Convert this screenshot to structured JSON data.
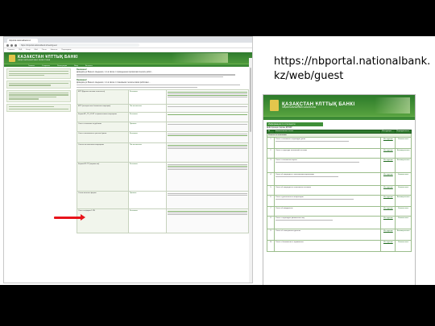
{
  "caption": {
    "url": "https://nbportal.nationalbank.kz/web/guest"
  },
  "screenshot_left": {
    "browser": {
      "tab_title": "nbportal.nationalbank.kz",
      "address": "https://nbportal.nationalbank.kz/web/guest",
      "bookmarks": [
        "Сервисы",
        "ГБД",
        "Kaspi",
        "Mail",
        "Почта",
        "Новости",
        "Переводчик"
      ]
    },
    "site": {
      "title": "КАЗАКСТАН ҰЛТТЫҚ БАНКІ",
      "subtitle": "НАЦИОНАЛЬНЫЙ БАНК КАЗАХСТАНА",
      "menu": [
        "Главная",
        "О портале",
        "Регистрация",
        "Вход",
        "Контакты"
      ]
    },
    "notices": [
      {
        "label": "Внимание!",
        "text": "Доводим до Вашего сведения, что в связи с проведением профилактических работ..."
      },
      {
        "label": "Внимание!",
        "text": "Доводим до Вашего сведения, что в связи с плановыми техническими работами..."
      }
    ],
    "table_rows": [
      {
        "name": "ЕРП (Единая система отчетности)",
        "link": "Регламент"
      },
      {
        "name": "ЕРП (электронные банковские операции)",
        "link": "Постановление"
      },
      {
        "name": "Форма ЕР_ТР_01-ИТ по финансовым операциям",
        "link": "Регламент"
      },
      {
        "name": "Отчет о платежах за рубежом",
        "link": "Правила"
      },
      {
        "name": "Отчет о вложениях в ценные бумаги",
        "link": "Регламент"
      },
      {
        "name": "Отчеты по валютным операциям",
        "link": "Постановление"
      },
      {
        "name": "Формы ЕР-ТП (первичные)",
        "link": "Регламент"
      },
      {
        "name": "Статистическая форма",
        "link": "Правила"
      },
      {
        "name": "Отчет по форме 1-ПБ",
        "link": "Регламент"
      }
    ]
  },
  "screenshot_right": {
    "site": {
      "title": "ҚАЗАҚСТАН ҰЛТТЫҚ БАНКІ",
      "subtitle": "НАЦИОНАЛЬНЫЙ БАНК КАЗАХСТАНА"
    },
    "section": "Информация по отчетности",
    "caption": "Действующие формы ДПСБР",
    "columns": [
      "№",
      "Наименование отчета",
      "Инструкция",
      "Периодичность"
    ],
    "groups": [
      {
        "title": "Отчеты по платежам",
        "rows": [
          {
            "num": "1",
            "name": "Отчет о платежах и переводах денег",
            "link": "Инструкция",
            "period": "Ежемесячно"
          },
          {
            "num": "2",
            "name": "Отчет о структуре платежной системы",
            "link": "Инструкция",
            "period": "Ежеквартально"
          },
          {
            "num": "3",
            "name": "Отчет о платежных картах",
            "link": "Инструкция",
            "period": "Ежеквартально"
          },
          {
            "num": "4",
            "name": "Отчет об операциях с платежными карточками",
            "link": "Инструкция",
            "period": "Ежемесячно"
          },
          {
            "num": "5",
            "name": "Отчет об операциях в платежных системах",
            "link": "Инструкция",
            "period": "Ежемесячно"
          },
          {
            "num": "6",
            "name": "Отчет о деятельности операторов",
            "link": "Инструкция",
            "period": "Ежеквартально"
          },
          {
            "num": "7",
            "name": "Отчет об инцидентах",
            "link": "Инструкция",
            "period": "Ежемесячно"
          },
          {
            "num": "8",
            "name": "Отчет о переводах физических лиц",
            "link": "Инструкция",
            "period": "Ежемесячно"
          },
          {
            "num": "9",
            "name": "Отчет об электронных деньгах",
            "link": "Инструкция",
            "period": "Ежеквартально"
          },
          {
            "num": "10",
            "name": "Отчет о банкоматах и терминалах",
            "link": "Инструкция",
            "period": "Ежемесячно"
          }
        ]
      }
    ]
  }
}
